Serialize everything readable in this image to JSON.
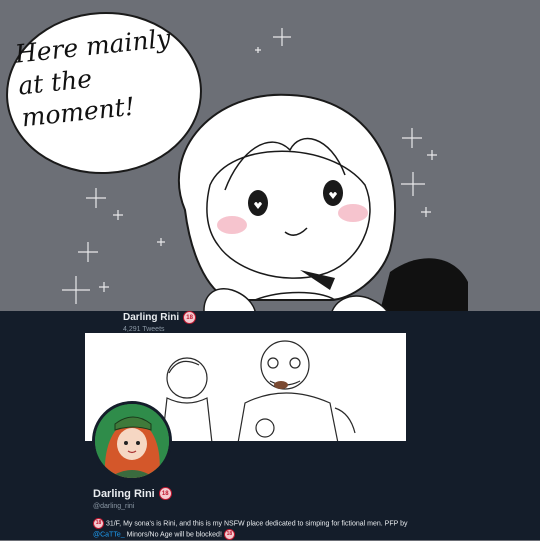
{
  "speech_bubble": {
    "text": "Here mainly\nat the\nmoment!"
  },
  "profile": {
    "header_name": "Darling Rini",
    "tweet_count": "4,291 Tweets",
    "name": "Darling Rini",
    "handle": "@darling_rini",
    "age_badge": "18",
    "bio": {
      "part1": "31/F, My sona's is Rini, and this is my NSFW place dedicated to simping for fictional men. PFP by ",
      "link": "@CaTTe_",
      "part2": " Minors/No Age will be blocked! "
    }
  },
  "colors": {
    "background_gray": "#6c6f76",
    "panel_navy": "#141d2a",
    "link_blue": "#1d9bf0",
    "badge_red": "#c0172f"
  }
}
